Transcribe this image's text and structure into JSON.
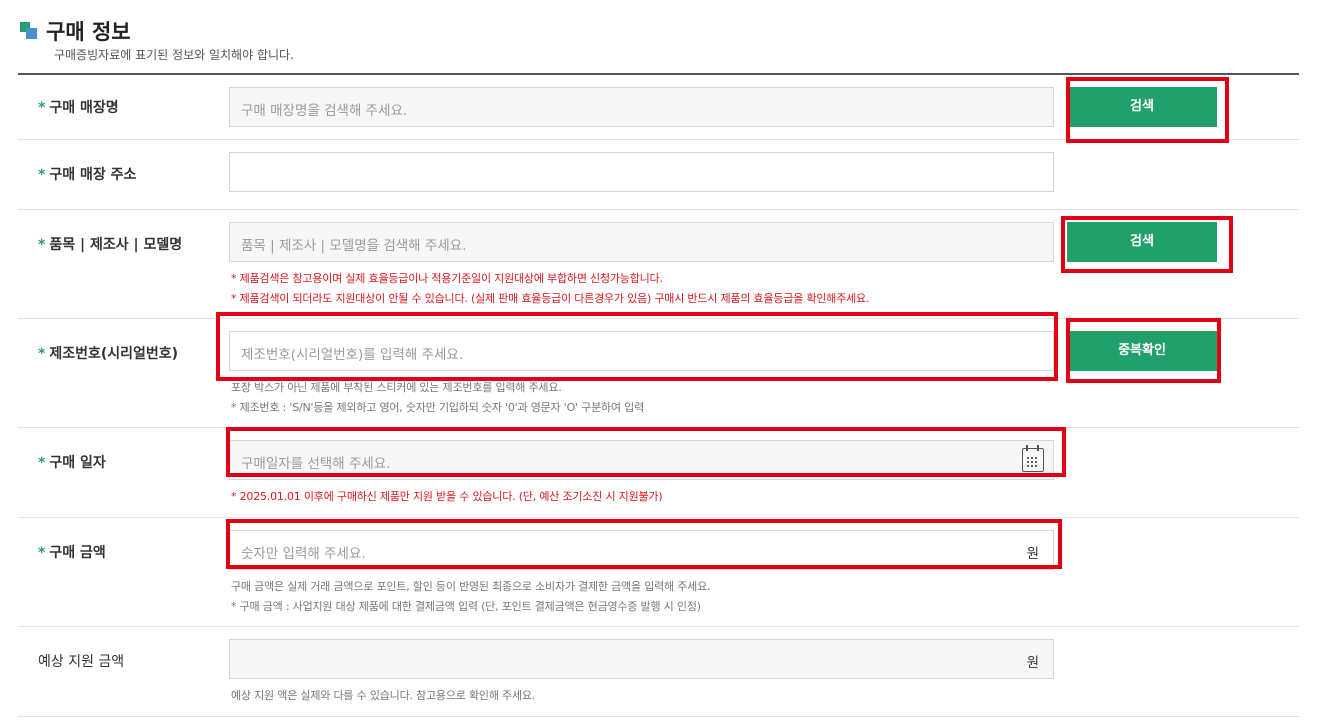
{
  "section": {
    "title": "구매 정보",
    "subtitle": "구매증빙자료에 표기된 정보와 일치해야 합니다."
  },
  "fields": {
    "store_name": {
      "label": "구매 매장명",
      "required": "*",
      "placeholder": "구매 매장명을 검색해 주세요.",
      "button": "검색"
    },
    "store_address": {
      "label": "구매 매장 주소",
      "required": "*",
      "value": ""
    },
    "product": {
      "label": "품목 | 제조사 | 모델명",
      "required": "*",
      "placeholder": "품목 | 제조사 | 모델명을 검색해 주세요.",
      "button": "검색",
      "notes": [
        "* 제품검색은 참고용이며 실제 효율등급이나 적용기준일이 지원대상에 부합하면 신청가능합니다.",
        "* 제품검색이 되더라도 지원대상이 안될 수 있습니다. (실제 판매 효율등급이 다른경우가 있음) 구매시 반드시 제품의 효율등급을 확인해주세요."
      ]
    },
    "serial": {
      "label": "제조번호(시리얼번호)",
      "required": "*",
      "placeholder": "제조번호(시리얼번호)를 입력해 주세요.",
      "button": "중복확인",
      "notes": [
        "포장 박스가 아닌 제품에 부착된 스티커에 있는 제조번호를 입력해 주세요.",
        "* 제조번호 : 'S/N'등을 제외하고 영어, 숫자만 기입하되 숫자 '0'과 영문자 'O' 구분하여 입력"
      ]
    },
    "purchase_date": {
      "label": "구매 일자",
      "required": "*",
      "placeholder": "구매일자를 선택해 주세요.",
      "icon": "calendar-icon",
      "notes": [
        "*  2025.01.01 이후에 구매하신 제품만 지원 받을 수 있습니다. (단, 예산 조기소진 시 지원불가)"
      ]
    },
    "amount": {
      "label": "구매 금액",
      "required": "*",
      "placeholder": "숫자만 입력해 주세요.",
      "unit": "원",
      "notes": [
        "구매 금액은 실제 거래 금액으로 포인트, 할인 등이 반영된 최종으로 소비자가 결제한 금액을 입력해 주세요.",
        "* 구매 금액 : 사업지원 대상 제품에 대한 결제금액 입력 (단, 포인트 결제금액은 현금영수증 발행 시 인정)"
      ]
    },
    "expected_support": {
      "label": "예상 지원 금액",
      "value": "",
      "unit": "원",
      "notes": [
        "예상 지원 액은 실제와 다를 수 있습니다. 참고용으로 확인해 주세요."
      ]
    }
  },
  "colors": {
    "accent_green": "#22a06b",
    "required_star": "#2a9d6e",
    "warning_red": "#d9181f",
    "highlight_red": "#e30012"
  }
}
